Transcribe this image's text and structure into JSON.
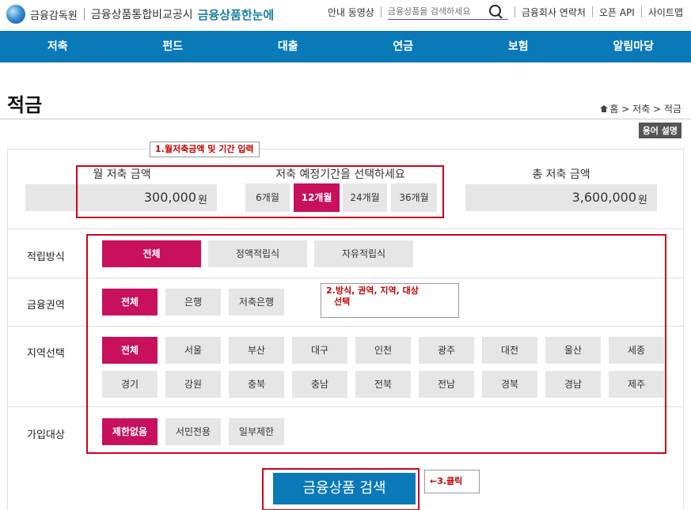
{
  "header": {
    "logo_fss": "금융감독원",
    "logo_site": "금융상품통합비교공시",
    "logo_brand": "금융상품한눈에",
    "guide_video": "안내 동영상",
    "search_placeholder": "금융상품을 검색하세요",
    "company_contacts": "금융회사 연락처",
    "open_api": "오픈 API",
    "sitemap": "사이트맵"
  },
  "nav": {
    "items": [
      "저축",
      "펀드",
      "대출",
      "연금",
      "보험",
      "알림마당"
    ]
  },
  "page": {
    "title": "적금",
    "breadcrumb": [
      "홈",
      "저축",
      "적금"
    ],
    "glossary": "용어 설명"
  },
  "amounts": {
    "monthly_label": "월 저축 금액",
    "monthly_value": "300,000",
    "unit": "원",
    "period_label": "저축 예정기간을 선택하세요",
    "periods": [
      "6개월",
      "12개월",
      "24개월",
      "36개월"
    ],
    "selected_period": "12개월",
    "total_label": "총 저축 금액",
    "total_value": "3,600,000"
  },
  "filters": {
    "method": {
      "label": "적립방식",
      "options": [
        "전체",
        "정액적립식",
        "자유적립식"
      ],
      "selected": "전체"
    },
    "sector": {
      "label": "금융권역",
      "options": [
        "전체",
        "은행",
        "저축은행"
      ],
      "selected": "전체"
    },
    "region": {
      "label": "지역선택",
      "options": [
        "전체",
        "서울",
        "부산",
        "대구",
        "인천",
        "광주",
        "대전",
        "울산",
        "세종",
        "경기",
        "강원",
        "충북",
        "충남",
        "전북",
        "전남",
        "경북",
        "경남",
        "제주"
      ],
      "selected": "전체"
    },
    "target": {
      "label": "가입대상",
      "options": [
        "제한없음",
        "서민전용",
        "일부제한"
      ],
      "selected": "제한없음"
    }
  },
  "search_button": "금융상품 검색",
  "annotations": {
    "note1": "1.월저축금액 및 기간 입력",
    "note2_line1": "2.방식, 권역, 지역, 대상",
    "note2_line2": "선택",
    "note3": "←3.클릭"
  },
  "colors": {
    "nav_blue": "#0a79b8",
    "active_magenta": "#c8105c",
    "annotation_red": "#d0021b"
  }
}
